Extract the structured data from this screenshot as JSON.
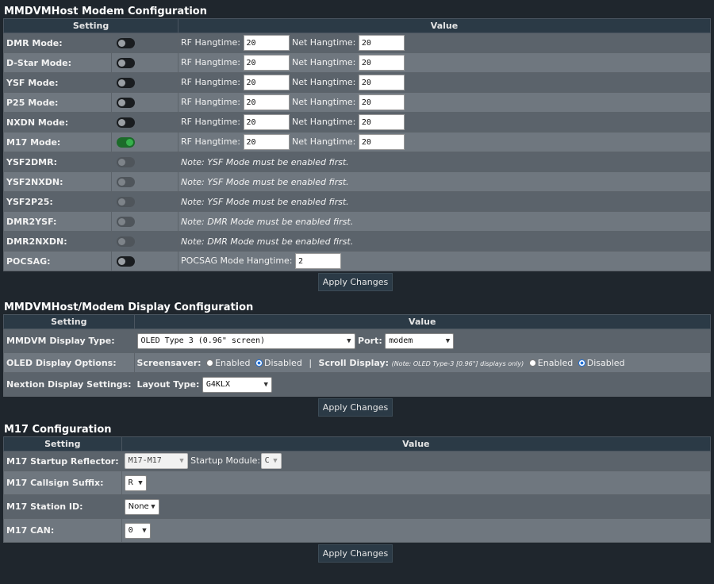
{
  "modem": {
    "title": "MMDVMHost Modem Configuration",
    "col_setting": "Setting",
    "col_value": "Value",
    "rf_label": "RF Hangtime:",
    "net_label": "Net Hangtime:",
    "modes": [
      {
        "label": "DMR Mode:",
        "on": false,
        "rf": "20",
        "net": "20"
      },
      {
        "label": "D-Star Mode:",
        "on": false,
        "rf": "20",
        "net": "20"
      },
      {
        "label": "YSF Mode:",
        "on": false,
        "rf": "20",
        "net": "20"
      },
      {
        "label": "P25 Mode:",
        "on": false,
        "rf": "20",
        "net": "20"
      },
      {
        "label": "NXDN Mode:",
        "on": false,
        "rf": "20",
        "net": "20"
      },
      {
        "label": "M17 Mode:",
        "on": true,
        "rf": "20",
        "net": "20"
      }
    ],
    "cross": [
      {
        "label": "YSF2DMR:",
        "note": "Note: YSF Mode must be enabled first."
      },
      {
        "label": "YSF2NXDN:",
        "note": "Note: YSF Mode must be enabled first."
      },
      {
        "label": "YSF2P25:",
        "note": "Note: YSF Mode must be enabled first."
      },
      {
        "label": "DMR2YSF:",
        "note": "Note: DMR Mode must be enabled first."
      },
      {
        "label": "DMR2NXDN:",
        "note": "Note: DMR Mode must be enabled first."
      }
    ],
    "pocsag": {
      "label": "POCSAG:",
      "hang_label": "POCSAG Mode Hangtime:",
      "value": "2"
    },
    "apply": "Apply Changes"
  },
  "display": {
    "title": "MMDVMHost/Modem Display Configuration",
    "col_setting": "Setting",
    "col_value": "Value",
    "type_label": "MMDVM Display Type:",
    "type_value": "OLED Type 3 (0.96\" screen)",
    "port_label": "Port:",
    "port_value": "modem",
    "oled_label": "OLED Display Options:",
    "screensaver_label": "Screensaver:",
    "enabled": "Enabled",
    "disabled": "Disabled",
    "divider": "|",
    "scroll_label": "Scroll Display:",
    "scroll_note": "(Note: OLED Type-3 [0.96\"] displays only)",
    "nextion_label": "Nextion Display Settings:",
    "layout_label": "Layout Type:",
    "layout_value": "G4KLX",
    "apply": "Apply Changes"
  },
  "m17": {
    "title": "M17 Configuration",
    "col_setting": "Setting",
    "col_value": "Value",
    "reflector_label": "M17 Startup Reflector:",
    "reflector_value": "M17-M17",
    "module_label": "Startup Module:",
    "module_value": "C",
    "suffix_label": "M17 Callsign Suffix:",
    "suffix_value": "R",
    "station_label": "M17 Station ID:",
    "station_value": "None",
    "can_label": "M17 CAN:",
    "can_value": "0",
    "apply": "Apply Changes"
  },
  "icons": {
    "dropdown": "chevron-down-icon"
  },
  "colors": {
    "toggle_on": "#36b14c",
    "header_bg": "#2b3a46",
    "radio_checked": "#1e6fd9"
  }
}
